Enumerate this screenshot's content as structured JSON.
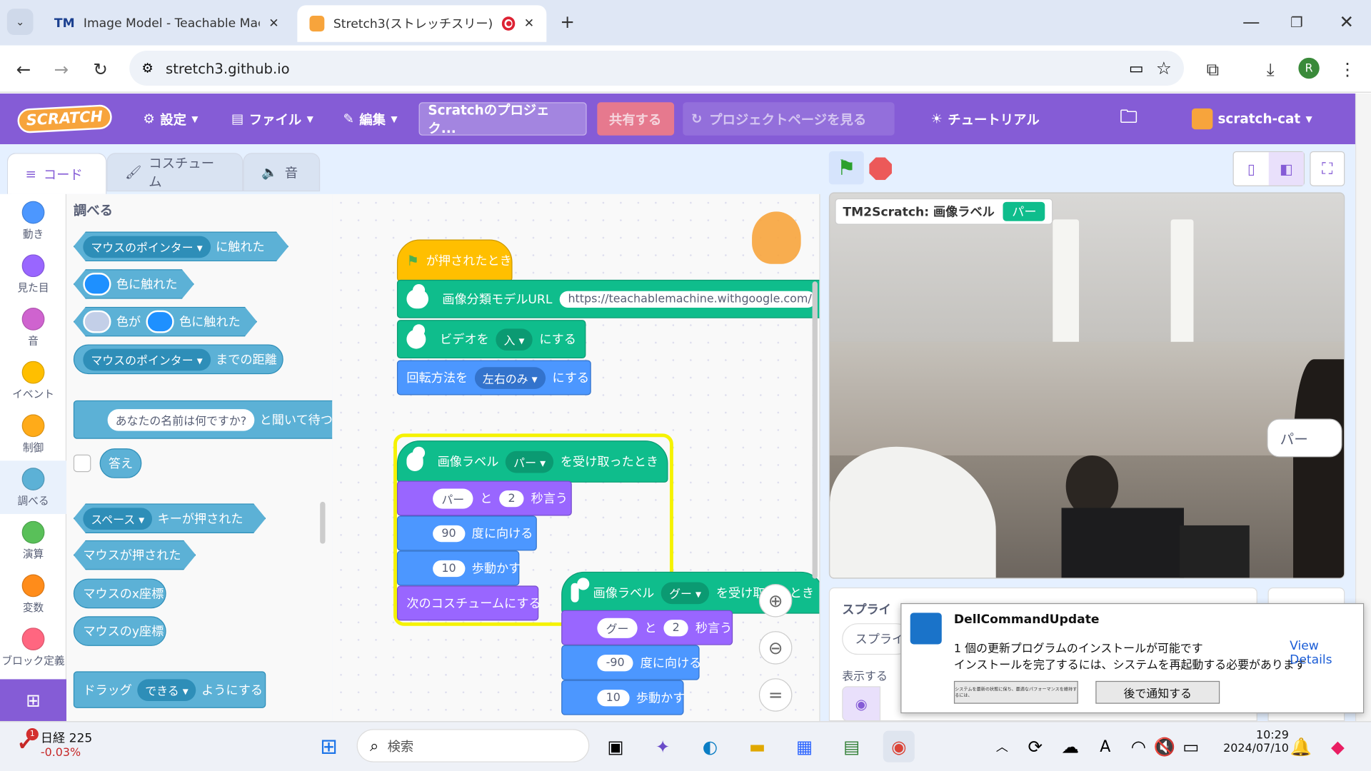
{
  "browser": {
    "tabs": [
      {
        "label": "Image Model - Teachable Mach",
        "icon": "TM"
      },
      {
        "label": "Stretch3(ストレッチスリー)"
      }
    ],
    "url": "stretch3.github.io",
    "profile": "R"
  },
  "scratch": {
    "menu": {
      "settings": "設定",
      "file": "ファイル",
      "edit": "編集",
      "project_title": "Scratchのプロジェク...",
      "share": "共有する",
      "see_project": "プロジェクトページを見る",
      "tutorials": "チュートリアル",
      "username": "scratch-cat",
      "logo": "SCRATCH"
    },
    "editor_tabs": {
      "code": "コード",
      "costumes": "コスチューム",
      "sounds": "音"
    },
    "categories": [
      {
        "label": "動き",
        "color": "#4c97ff"
      },
      {
        "label": "見た目",
        "color": "#9966ff"
      },
      {
        "label": "音",
        "color": "#cf63cf"
      },
      {
        "label": "イベント",
        "color": "#ffbf00"
      },
      {
        "label": "制御",
        "color": "#ffab19"
      },
      {
        "label": "調べる",
        "color": "#5cb1d6"
      },
      {
        "label": "演算",
        "color": "#59c059"
      },
      {
        "label": "変数",
        "color": "#ff8c1a"
      },
      {
        "label": "ブロック定義",
        "color": "#ff6680"
      }
    ],
    "palette": {
      "heading": "調べる",
      "touching_mouse": {
        "dropdown": "マウスのポインター",
        "label": "に触れた"
      },
      "touching_color": {
        "label": "色に触れた",
        "color": "#1e90ff"
      },
      "color_touching": {
        "label1": "色が",
        "label2": "色に触れた",
        "color1": "#c3cfe8",
        "color2": "#1e90ff"
      },
      "distance": {
        "dropdown": "マウスのポインター",
        "label": "までの距離"
      },
      "ask": {
        "question": "あなたの名前は何ですか?",
        "label": "と聞いて待つ"
      },
      "answer": "答え",
      "key_pressed": {
        "dropdown": "スペース",
        "label": "キーが押された"
      },
      "mouse_down": "マウスが押された",
      "mouse_x": "マウスのx座標",
      "mouse_y": "マウスのy座標",
      "drag": {
        "label1": "ドラッグ",
        "dropdown": "できる",
        "label2": "ようにする"
      }
    },
    "scripts": {
      "s1": {
        "hat": "が押されたとき",
        "url_label": "画像分類モデルURL",
        "url_value": "https://teachablemachine.withgoogle.com/models/",
        "video_label": "ビデオを",
        "video_dropdown": "入",
        "video_suffix": "にする",
        "rot_label": "回転方法を",
        "rot_dropdown": "左右のみ",
        "rot_suffix": "にする"
      },
      "s2": {
        "hat_label": "画像ラベル",
        "hat_dropdown": "パー",
        "hat_suffix": "を受け取ったとき",
        "say_text": "パー",
        "say_and": "と",
        "say_secs": "2",
        "say_suffix": "秒言う",
        "dir": "90",
        "dir_label": "度に向ける",
        "move": "10",
        "move_label": "歩動かす",
        "costume": "次のコスチュームにする"
      },
      "s3": {
        "hat_label": "画像ラベル",
        "hat_dropdown": "グー",
        "hat_suffix": "を受け取ったとき",
        "say_text": "グー",
        "say_and": "と",
        "say_secs": "2",
        "say_suffix": "秒言う",
        "dir": "-90",
        "dir_label": "度に向ける",
        "move": "10",
        "move_label": "歩動かす"
      }
    },
    "stage": {
      "monitor_label": "TM2Scratch: 画像ラベル",
      "monitor_value": "パー",
      "speech": "パー"
    },
    "sprite_pane": {
      "title": "スプライ",
      "sprite_label": "スプライ",
      "show": "表示する"
    }
  },
  "notification": {
    "app": "DellCommandUpdate",
    "line1": "1 個の更新プログラムのインストールが可能です",
    "line2": "インストールを完了するには、システムを再起動する必要があります",
    "link": "View Details",
    "button1": "システムを最新の状態に保ち、最適なパフォーマンスを維持するには、",
    "button2": "後で通知する"
  },
  "taskbar": {
    "stock_name": "日経 225",
    "stock_change": "-0.03%",
    "badge": "1",
    "search": "検索",
    "time": "10:29",
    "date": "2024/07/10",
    "ime": "A"
  }
}
